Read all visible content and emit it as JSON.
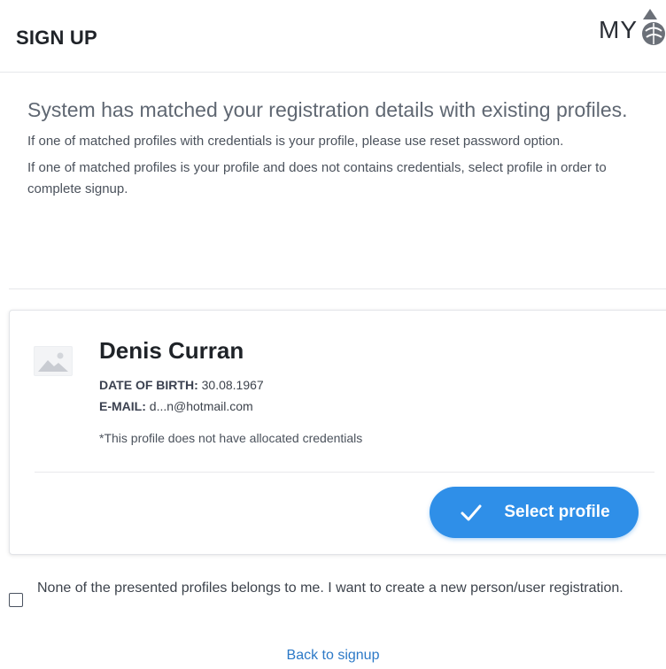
{
  "header": {
    "title": "SIGN UP",
    "logo_text": "MY",
    "logo_icon": "shell-logo-icon"
  },
  "intro": {
    "main": "System has matched your registration details with existing profiles.",
    "line1": "If one of matched profiles with credentials is your profile, please use reset password option.",
    "line2": "If one of matched profiles is your profile and does not contains credentials, select profile in order to complete signup."
  },
  "profile": {
    "avatar_icon": "image-placeholder-icon",
    "name": "Denis Curran",
    "dob_label": "DATE OF BIRTH:",
    "dob_value": "30.08.1967",
    "email_label": "E-MAIL:",
    "email_value": "d...n@hotmail.com",
    "note": "*This profile does not have allocated credentials",
    "select_label": "Select profile"
  },
  "none_option": {
    "checked": false,
    "text": "None of the presented profiles belongs to me. I want to create a new person/user registration."
  },
  "footer": {
    "back_label": "Back to signup"
  },
  "colors": {
    "accent": "#2f8fe8",
    "link": "#2c79c7"
  }
}
